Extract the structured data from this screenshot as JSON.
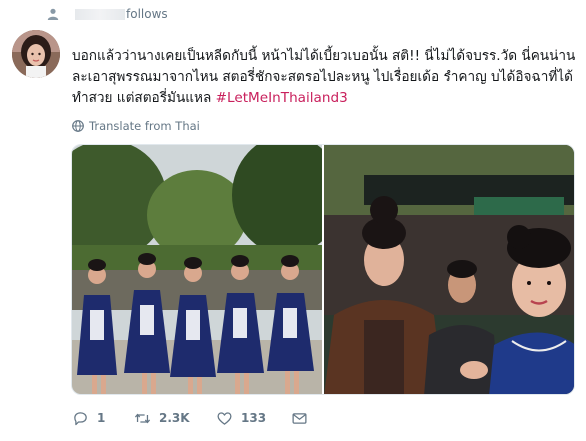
{
  "header": {
    "follows_text": "follows"
  },
  "tweet": {
    "text_plain": "บอกแล้วว่านางเคยเป็นหลีดกับนี้ หน้าไม่ได้เบี้ยวเบอนั้น สติ!! นี่ไม่ได้จบรร.วัด นี่คนน่าน ละเอาสุพรรณมาจากไหน สตอรี่ชักจะสตรอไปละหนู ไปเรื่อยเด้อ รำคาญ บได้อิจฉาที่ได้ทำสวย แต่สตอรี่มันแหล ",
    "hashtag": "#LetMeInThailand3",
    "translate_label": "Translate from Thai"
  },
  "actions": {
    "reply_count": "1",
    "retweet_count": "2.3K",
    "like_count": "133"
  },
  "icons": {
    "follows": "person-icon",
    "translate": "globe-icon",
    "reply": "reply-icon",
    "retweet": "retweet-icon",
    "like": "heart-icon",
    "message": "envelope-icon"
  },
  "colors": {
    "hashtag": "#c9215d",
    "secondary_text": "#657786",
    "text": "#14171a"
  }
}
